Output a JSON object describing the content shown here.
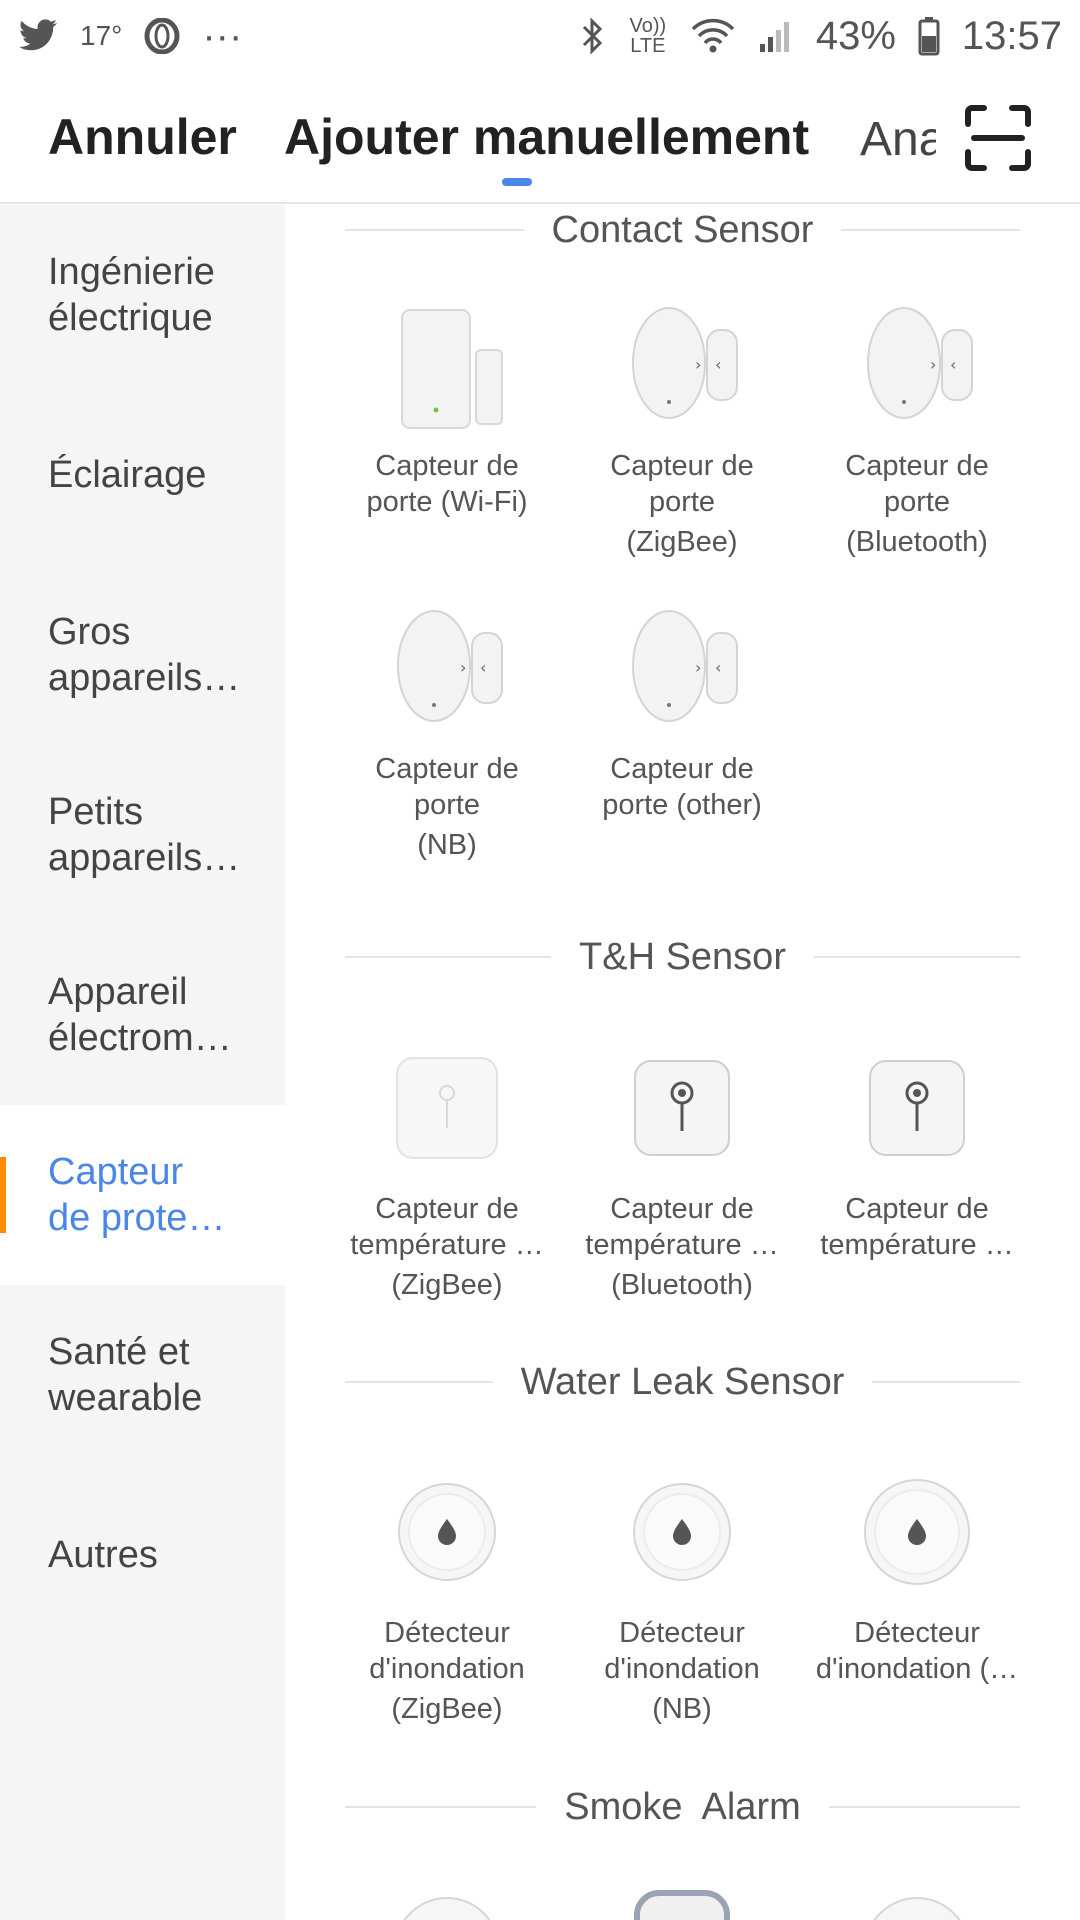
{
  "status_bar": {
    "temperature": "17°",
    "more": "···",
    "volte": "Vo)) LTE",
    "battery": "43%",
    "time": "13:57"
  },
  "header": {
    "cancel_label": "Annuler",
    "active_tab": "Ajouter manuellement",
    "next_tab": "Analyser"
  },
  "sidebar": {
    "items": [
      {
        "line1": "Ingénierie",
        "line2": "électrique"
      },
      {
        "line1": "Éclairage",
        "line2": ""
      },
      {
        "line1": "Gros",
        "line2": "appareils…"
      },
      {
        "line1": "Petits",
        "line2": "appareils…"
      },
      {
        "line1": "Appareil",
        "line2": "électrom…"
      },
      {
        "line1": "Capteur",
        "line2": "de prote…"
      },
      {
        "line1": "Santé et",
        "line2": "wearable"
      },
      {
        "line1": "Autres",
        "line2": ""
      }
    ]
  },
  "sections": [
    {
      "title": "Contact Sensor",
      "devices": [
        {
          "l1": "Capteur de",
          "l2": "porte (Wi-Fi)",
          "l3": ""
        },
        {
          "l1": "Capteur de",
          "l2": "porte",
          "l3": "(ZigBee)"
        },
        {
          "l1": "Capteur de",
          "l2": "porte",
          "l3": "(Bluetooth)"
        },
        {
          "l1": "Capteur de",
          "l2": "porte",
          "l3": "(NB)"
        },
        {
          "l1": "Capteur de",
          "l2": "porte (other)",
          "l3": ""
        }
      ]
    },
    {
      "title": "T&H Sensor",
      "devices": [
        {
          "l1": "Capteur de",
          "l2": "température …",
          "l3": "(ZigBee)"
        },
        {
          "l1": "Capteur de",
          "l2": "température …",
          "l3": "(Bluetooth)"
        },
        {
          "l1": "Capteur de",
          "l2": "température …",
          "l3": ""
        }
      ]
    },
    {
      "title": "Water Leak Sensor",
      "devices": [
        {
          "l1": "Détecteur",
          "l2": "d'inondation",
          "l3": "(ZigBee)"
        },
        {
          "l1": "Détecteur",
          "l2": "d'inondation",
          "l3": "(NB)"
        },
        {
          "l1": "Détecteur",
          "l2": "d'inondation (…",
          "l3": ""
        }
      ]
    },
    {
      "title": "Smoke  Alarm",
      "devices": []
    }
  ],
  "colors": {
    "accent": "#4a86e8",
    "indicator": "#ff8a00",
    "sidebar_bg": "#f5f5f5"
  }
}
